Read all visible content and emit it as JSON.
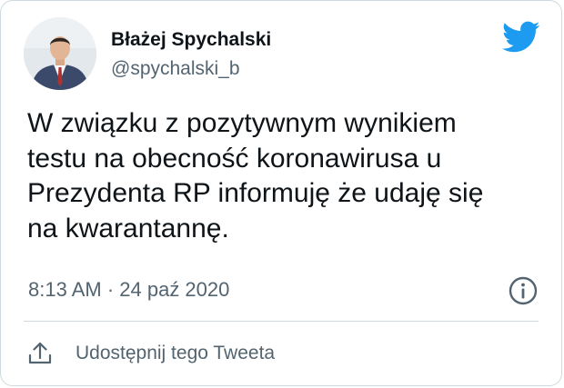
{
  "tweet": {
    "author_name": "Błażej Spychalski",
    "author_handle": "@spychalski_b",
    "text_lines": [
      "W związku z pozytywnym wynikiem",
      "testu na obecność koronawirusa u",
      "Prezydenta RP informuję że udaję się",
      "na kwarantannę."
    ],
    "timestamp": "8:13 AM · 24 paź 2020"
  },
  "actions": {
    "share_label": "Udostępnij tego Tweeta"
  },
  "icons": {
    "brand": "twitter-bird-icon",
    "info": "info-icon",
    "share": "share-icon"
  },
  "colors": {
    "twitter_blue": "#1d9bf0",
    "secondary_text": "#536471",
    "primary_text": "#0f1419",
    "border": "#cfd9de"
  }
}
